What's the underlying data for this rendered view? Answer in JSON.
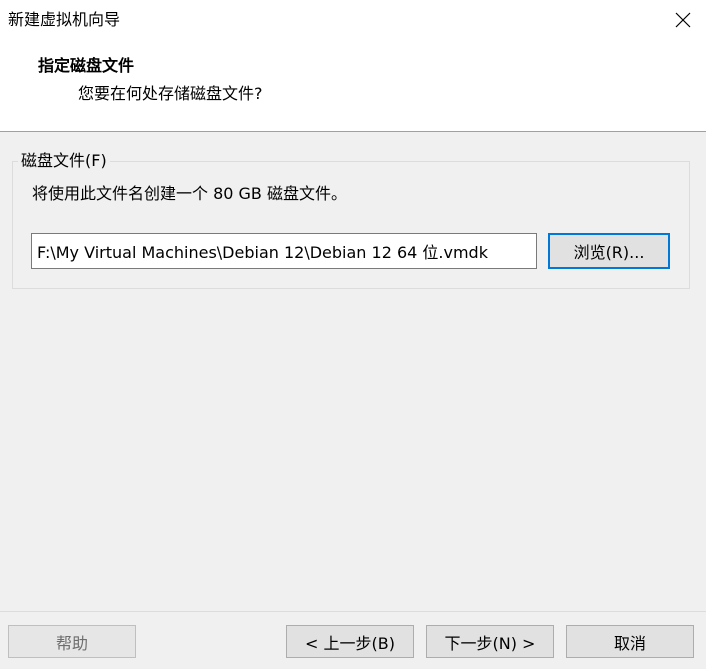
{
  "window": {
    "title": "新建虚拟机向导",
    "close_icon": "close-icon"
  },
  "header": {
    "title": "指定磁盘文件",
    "subtitle": "您要在何处存储磁盘文件?"
  },
  "disk_file_group": {
    "label": "磁盘文件(F)",
    "description": "将使用此文件名创建一个 80 GB 磁盘文件。",
    "path_value": "F:\\My Virtual Machines\\Debian 12\\Debian 12 64 位.vmdk",
    "browse_label": "浏览(R)..."
  },
  "footer": {
    "help_label": "帮助",
    "back_label": "< 上一步(B)",
    "next_label": "下一步(N) >",
    "cancel_label": "取消"
  },
  "colors": {
    "focus_border": "#0078d7",
    "dialog_bg": "#f0f0f0",
    "header_bg": "#ffffff"
  }
}
